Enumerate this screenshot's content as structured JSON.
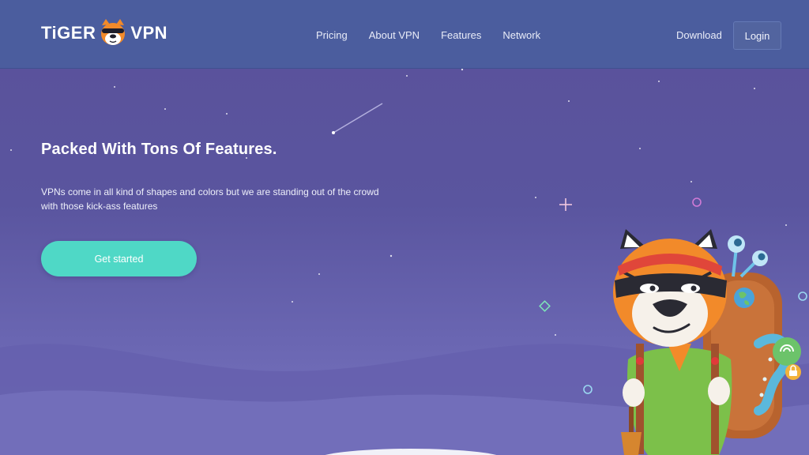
{
  "brand": {
    "name_left": "TiGER",
    "name_right": "VPN"
  },
  "nav": {
    "items": [
      "Pricing",
      "About VPN",
      "Features",
      "Network"
    ],
    "download_label": "Download",
    "login_label": "Login"
  },
  "hero": {
    "title": "Packed With Tons Of Features.",
    "description": "VPNs come in all kind of shapes and colors but we are standing out of the crowd with those kick-ass features",
    "cta_label": "Get started"
  },
  "colors": {
    "header": "#4b5d9e",
    "background": "#5a519a",
    "cta": "#4fd8c6"
  }
}
